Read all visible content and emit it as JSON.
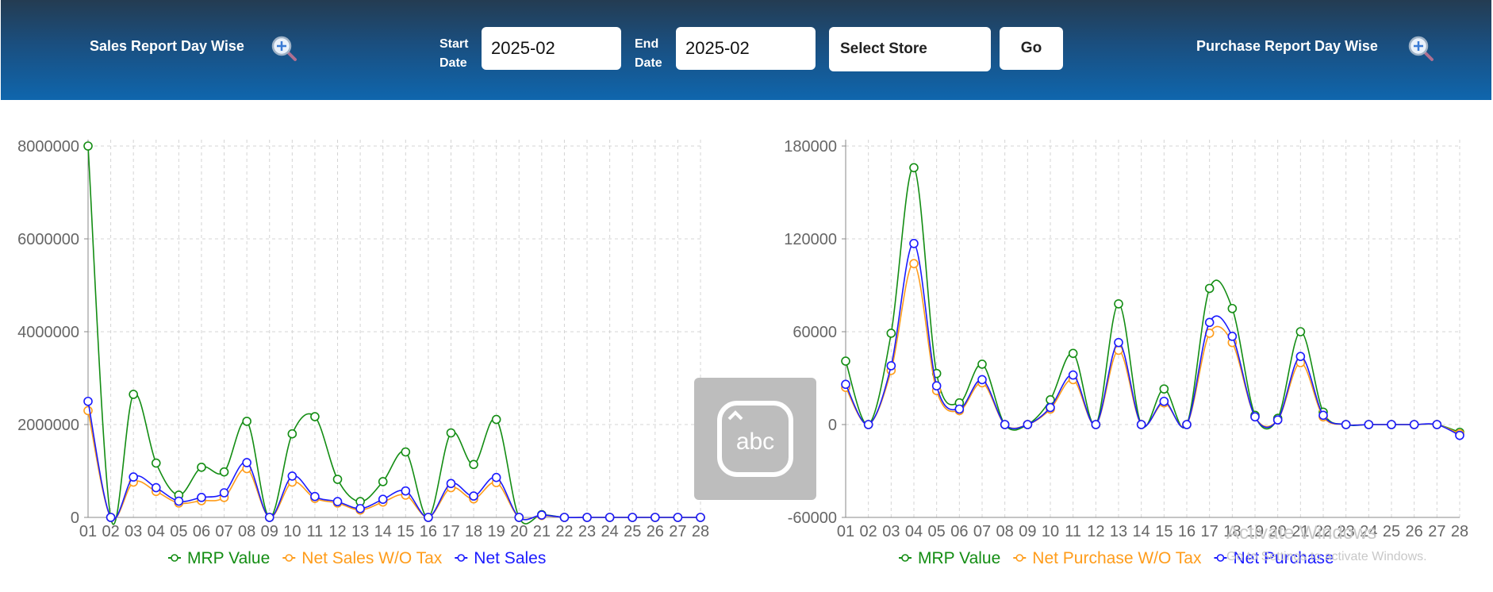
{
  "header": {
    "sales_title": "Sales Report Day Wise",
    "purchase_title": "Purchase Report Day Wise",
    "start_label_1": "Start",
    "start_label_2": "Date",
    "end_label_1": "End",
    "end_label_2": "Date",
    "start_value": "2025-02",
    "end_value": "2025-02",
    "store_label": "Select Store",
    "go_label": "Go"
  },
  "colors": {
    "mrp": "#138d13",
    "wotax": "#ff9c1a",
    "net": "#1a1aff"
  },
  "keyboard_tile": {
    "icon": "keyboard-abc-icon",
    "text": "abc"
  },
  "watermark": {
    "title": "Activate Windows",
    "subtitle": "Go to Settings to activate Windows."
  },
  "chart_data": [
    {
      "type": "line",
      "x": [
        "01",
        "02",
        "03",
        "04",
        "05",
        "06",
        "07",
        "08",
        "09",
        "10",
        "11",
        "12",
        "13",
        "14",
        "15",
        "16",
        "17",
        "18",
        "19",
        "20",
        "21",
        "22",
        "23",
        "24",
        "25",
        "26",
        "27",
        "28"
      ],
      "ylim": [
        0,
        8000000
      ],
      "yticks": [
        0,
        2000000,
        4000000,
        6000000,
        8000000
      ],
      "grid": true,
      "legend": "bottom",
      "series": [
        {
          "name": "MRP Value",
          "values": [
            8000000,
            0,
            2650000,
            1170000,
            480000,
            1080000,
            980000,
            2070000,
            0,
            1800000,
            2170000,
            820000,
            340000,
            770000,
            1410000,
            0,
            1820000,
            1140000,
            2110000,
            0,
            60000,
            0,
            0,
            0,
            0,
            0,
            0,
            0
          ]
        },
        {
          "name": "Net Sales W/O Tax",
          "values": [
            2300000,
            0,
            760000,
            560000,
            310000,
            360000,
            430000,
            1050000,
            0,
            760000,
            410000,
            310000,
            160000,
            330000,
            480000,
            0,
            640000,
            400000,
            750000,
            0,
            40000,
            0,
            0,
            0,
            0,
            0,
            0,
            0
          ]
        },
        {
          "name": "Net Sales",
          "values": [
            2500000,
            0,
            870000,
            640000,
            350000,
            430000,
            530000,
            1180000,
            0,
            890000,
            450000,
            340000,
            190000,
            390000,
            570000,
            0,
            730000,
            460000,
            860000,
            0,
            50000,
            0,
            0,
            0,
            0,
            0,
            0,
            0
          ]
        }
      ]
    },
    {
      "type": "line",
      "x": [
        "01",
        "02",
        "03",
        "04",
        "05",
        "06",
        "07",
        "08",
        "09",
        "10",
        "11",
        "12",
        "13",
        "14",
        "15",
        "16",
        "17",
        "18",
        "19",
        "20",
        "21",
        "22",
        "23",
        "24",
        "25",
        "26",
        "27",
        "28"
      ],
      "ylim": [
        -60000,
        180000
      ],
      "yticks": [
        -60000,
        0,
        60000,
        120000,
        180000
      ],
      "grid": true,
      "legend": "bottom",
      "series": [
        {
          "name": "MRP Value",
          "values": [
            41000,
            0,
            59000,
            166000,
            33000,
            14000,
            39000,
            0,
            0,
            16000,
            46000,
            0,
            78000,
            0,
            23000,
            0,
            88000,
            75000,
            6000,
            4000,
            60000,
            8000,
            0,
            0,
            0,
            0,
            0,
            -5000
          ]
        },
        {
          "name": "Net Purchase W/O Tax",
          "values": [
            24000,
            0,
            35000,
            104000,
            22000,
            9000,
            27000,
            0,
            0,
            10000,
            29000,
            0,
            48000,
            0,
            14000,
            0,
            59000,
            53000,
            5000,
            3000,
            40000,
            5000,
            0,
            0,
            0,
            0,
            0,
            -6000
          ]
        },
        {
          "name": "Net Purchase",
          "values": [
            26000,
            0,
            38000,
            117000,
            25000,
            10000,
            29000,
            0,
            0,
            11000,
            32000,
            0,
            53000,
            0,
            15000,
            0,
            66000,
            57000,
            5000,
            3000,
            44000,
            6000,
            0,
            0,
            0,
            0,
            0,
            -7000
          ]
        }
      ]
    }
  ]
}
